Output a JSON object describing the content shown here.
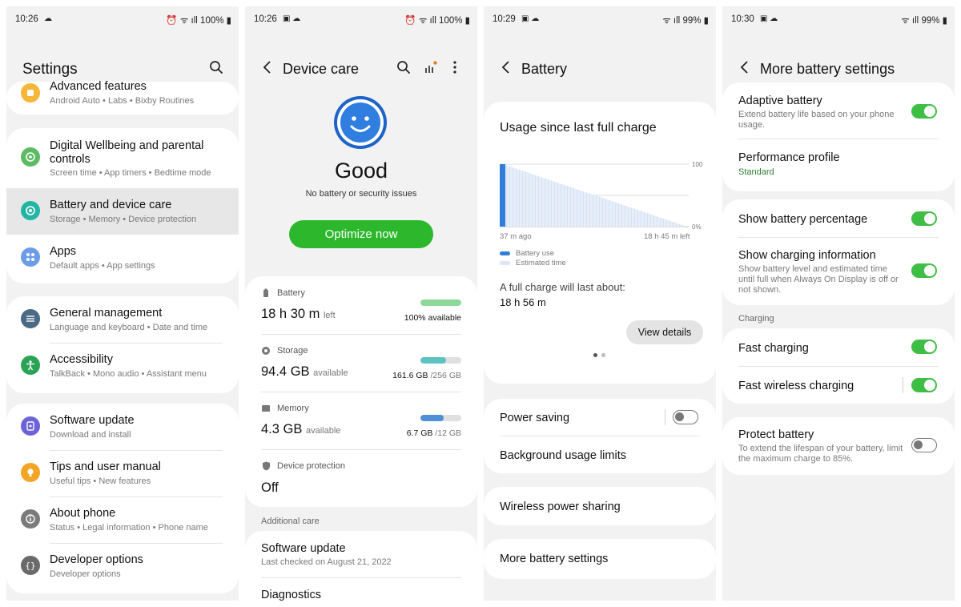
{
  "screen1": {
    "status": {
      "time": "10:26",
      "extra": "☁",
      "battery": "100%"
    },
    "title": "Settings",
    "items": [
      {
        "label": "Advanced features",
        "sub": "Android Auto  •  Labs  •  Bixby Routines"
      },
      {
        "label": "Digital Wellbeing and parental controls",
        "sub": "Screen time  •  App timers  •  Bedtime mode"
      },
      {
        "label": "Battery and device care",
        "sub": "Storage  •  Memory  •  Device protection"
      },
      {
        "label": "Apps",
        "sub": "Default apps  •  App settings"
      },
      {
        "label": "General management",
        "sub": "Language and keyboard  •  Date and time"
      },
      {
        "label": "Accessibility",
        "sub": "TalkBack  •  Mono audio  •  Assistant menu"
      },
      {
        "label": "Software update",
        "sub": "Download and install"
      },
      {
        "label": "Tips and user manual",
        "sub": "Useful tips  •  New features"
      },
      {
        "label": "About phone",
        "sub": "Status  •  Legal information  •  Phone name"
      },
      {
        "label": "Developer options",
        "sub": "Developer options"
      }
    ]
  },
  "screen2": {
    "status": {
      "time": "10:26",
      "extra": "▣ ☁",
      "battery": "100%"
    },
    "title": "Device care",
    "status_word": "Good",
    "status_sub": "No battery or security issues",
    "optimize_label": "Optimize now",
    "battery": {
      "label": "Battery",
      "value": "18 h 30 m",
      "unit": "left",
      "detail": "100% available",
      "fill": 100,
      "color": "#8ed89a"
    },
    "storage": {
      "label": "Storage",
      "value": "94.4 GB",
      "unit": "available",
      "detail_main": "161.6 GB",
      "detail_rest": " /256 GB",
      "fill": 63,
      "color": "#5cc4c0"
    },
    "memory": {
      "label": "Memory",
      "value": "4.3 GB",
      "unit": "available",
      "detail_main": "6.7 GB",
      "detail_rest": " /12 GB",
      "fill": 56,
      "color": "#4f8fd6"
    },
    "protection": {
      "label": "Device protection",
      "value": "Off"
    },
    "additional_care": "Additional care",
    "software_update": {
      "label": "Software update",
      "sub": "Last checked on August 21, 2022"
    },
    "diagnostics": "Diagnostics"
  },
  "screen3": {
    "status": {
      "time": "10:29",
      "extra": "▣ ☁",
      "battery": "99%"
    },
    "title": "Battery",
    "usage_title": "Usage since last full charge",
    "chart": {
      "y_top": "100",
      "y_bottom": "0%",
      "x_start": "37 m ago",
      "x_end": "18 h 45 m left",
      "legend_use": "Battery use",
      "legend_est": "Estimated time",
      "color_use": "#2f7fd8",
      "color_est": "#dbe7f7"
    },
    "full_charge_label": "A full charge will last about:",
    "full_charge_value": "18 h 56 m",
    "view_details": "View details",
    "power_saving": "Power saving",
    "background_limits": "Background usage limits",
    "wireless_sharing": "Wireless power sharing",
    "more_battery": "More battery settings"
  },
  "screen4": {
    "status": {
      "time": "10:30",
      "extra": "▣ ☁",
      "battery": "99%"
    },
    "title": "More battery settings",
    "adaptive": {
      "label": "Adaptive battery",
      "sub": "Extend battery life based on your phone usage."
    },
    "performance": {
      "label": "Performance profile",
      "sub": "Standard"
    },
    "show_percentage": "Show battery percentage",
    "charging_info": {
      "label": "Show charging information",
      "sub": "Show battery level and estimated time until full when Always On Display is off or not shown."
    },
    "charging_header": "Charging",
    "fast_charging": "Fast charging",
    "fast_wireless": "Fast wireless charging",
    "protect": {
      "label": "Protect battery",
      "sub": "To extend the lifespan of your battery, limit the maximum charge to 85%."
    }
  }
}
